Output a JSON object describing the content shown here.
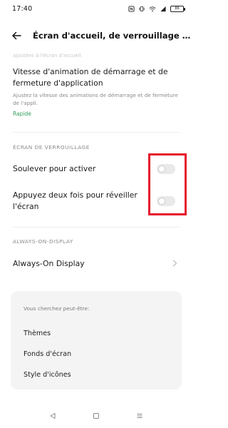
{
  "status_bar": {
    "time": "17:40",
    "battery": "86"
  },
  "header": {
    "title": "Écran d'accueil, de verrouillage et Always-On-Display"
  },
  "faded_text": "ajoutées à l'écran d'accueil.",
  "animation_setting": {
    "title": "Vitesse d'animation de démarrage et de fermeture d'application",
    "description": "Ajustez la vitesse des animations de démarrage et de fermeture de l'appli.",
    "value": "Rapide"
  },
  "lock_screen": {
    "section_label": "ÉCRAN DE VERROUILLAGE",
    "toggles": [
      {
        "label": "Soulever pour activer",
        "enabled": false
      },
      {
        "label": "Appuyez deux fois pour réveiller l'écran",
        "enabled": false
      }
    ]
  },
  "aod": {
    "section_label": "ALWAYS-ON-DISPLAY",
    "item_label": "Always-On Display"
  },
  "suggestions": {
    "heading": "Vous cherchez peut-être:",
    "items": [
      "Thèmes",
      "Fonds d'écran",
      "Style d'icônes"
    ]
  },
  "colors": {
    "accent_green": "#2f9e5a",
    "highlight_red": "#e6162c"
  }
}
